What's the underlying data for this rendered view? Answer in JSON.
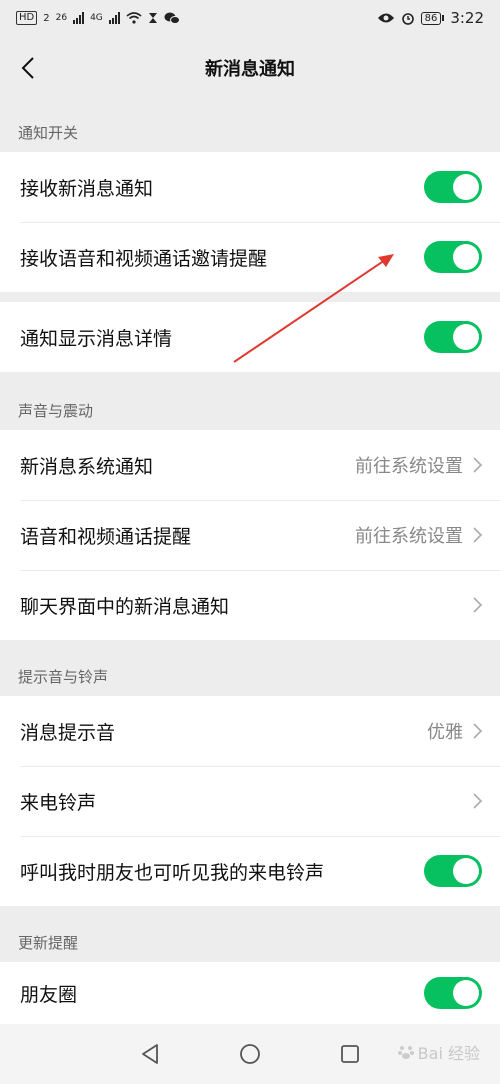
{
  "status": {
    "left_chips": [
      "HD",
      "2",
      "26",
      "4G"
    ],
    "battery": "86",
    "time": "3:22"
  },
  "header": {
    "title": "新消息通知",
    "back_icon": "chevron-left-icon"
  },
  "sections": {
    "notify": {
      "title": "通知开关",
      "items": [
        {
          "label": "接收新消息通知",
          "toggle": true
        },
        {
          "label": "接收语音和视频通话邀请提醒",
          "toggle": true
        }
      ],
      "detail": {
        "label": "通知显示消息详情",
        "toggle": true
      }
    },
    "sound": {
      "title": "声音与震动",
      "items": [
        {
          "label": "新消息系统通知",
          "value": "前往系统设置"
        },
        {
          "label": "语音和视频通话提醒",
          "value": "前往系统设置"
        },
        {
          "label": "聊天界面中的新消息通知",
          "value": ""
        }
      ]
    },
    "ringtone": {
      "title": "提示音与铃声",
      "items": [
        {
          "label": "消息提示音",
          "value": "优雅"
        },
        {
          "label": "来电铃声",
          "value": ""
        },
        {
          "label": "呼叫我时朋友也可听见我的来电铃声",
          "toggle": true
        }
      ]
    },
    "update": {
      "title": "更新提醒",
      "items": [
        {
          "label": "朋友圈",
          "toggle": true
        }
      ]
    }
  },
  "navbar": {
    "icons": [
      "back-triangle-icon",
      "home-circle-icon",
      "recents-square-icon"
    ]
  },
  "watermark": "Bai 经验",
  "colors": {
    "toggle_on": "#07c160",
    "background": "#ededed",
    "arrow": "#e03a2f"
  }
}
